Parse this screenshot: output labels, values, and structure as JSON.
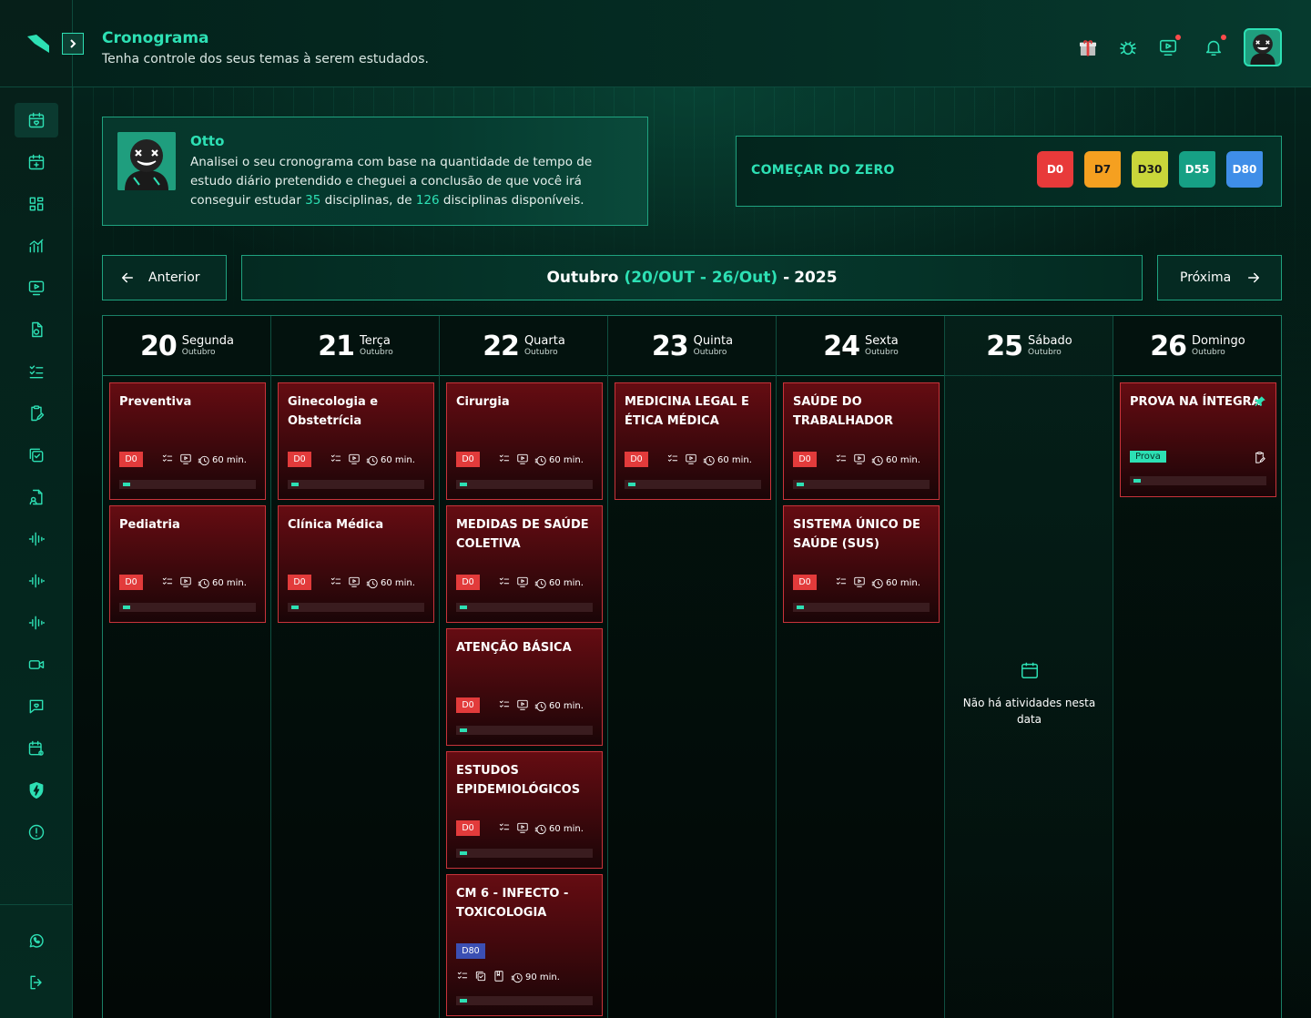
{
  "header": {
    "title": "Cronograma",
    "subtitle": "Tenha controle dos seus temas à serem estudados."
  },
  "otto": {
    "name": "Otto",
    "msg_part1": "Analisei o seu cronograma com base na quantidade de tempo de estudo diário pretendido e cheguei a conclusão de que você irá conseguir estudar ",
    "count_studied": "35",
    "msg_part2": " disciplinas, de ",
    "count_total": "126",
    "msg_part3": " disciplinas disponíveis."
  },
  "start_zero": {
    "title": "COMEÇAR DO ZERO",
    "tags": [
      {
        "label": "D0",
        "color": "#e83a3a",
        "text_color": "#ffffff"
      },
      {
        "label": "D7",
        "color": "#f5a020",
        "text_color": "#1a1a1a"
      },
      {
        "label": "D30",
        "color": "#c9d63a",
        "text_color": "#1a1a1a"
      },
      {
        "label": "D55",
        "color": "#16a085",
        "text_color": "#ffffff"
      },
      {
        "label": "D80",
        "color": "#3f8ee8",
        "text_color": "#ffffff"
      }
    ]
  },
  "week_nav": {
    "prev_label": "Anterior",
    "next_label": "Próxima",
    "month": "Outubro",
    "range": "(20/OUT - 26/Out)",
    "separator": "-",
    "year": "2025"
  },
  "calendar": {
    "days": [
      {
        "num": "20",
        "name": "Segunda",
        "month": "Outubro"
      },
      {
        "num": "21",
        "name": "Terça",
        "month": "Outubro"
      },
      {
        "num": "22",
        "name": "Quarta",
        "month": "Outubro"
      },
      {
        "num": "23",
        "name": "Quinta",
        "month": "Outubro"
      },
      {
        "num": "24",
        "name": "Sexta",
        "month": "Outubro"
      },
      {
        "num": "25",
        "name": "Sábado",
        "month": "Outubro"
      },
      {
        "num": "26",
        "name": "Domingo",
        "month": "Outubro"
      }
    ],
    "empty_text": "Não há atividades nesta data",
    "duration_60": "60 min.",
    "duration_90": "90 min.",
    "tag_d0": "D0",
    "tag_d80": "D80",
    "tasks": {
      "mon1": "Preventiva",
      "mon2": "Pediatria",
      "tue1": "Ginecologia e Obstetrícia",
      "tue2": "Clínica Médica",
      "wed1": "Cirurgia",
      "wed2": "MEDIDAS DE SAÚDE COLETIVA",
      "wed3": "ATENÇÃO BÁSICA",
      "wed4": "ESTUDOS EPIDEMIOLÓGICOS",
      "wed5": "CM 6 - INFECTO - TOXICOLOGIA",
      "thu1": "MEDICINA LEGAL E ÉTICA MÉDICA",
      "fri1": "SAÚDE DO TRABALHADOR",
      "fri2": "SISTEMA ÚNICO DE SAÚDE (SUS)",
      "sun1": "PROVA NA ÍNTEGRA",
      "sun1_badge": "Prova"
    },
    "progress": 0.05
  }
}
